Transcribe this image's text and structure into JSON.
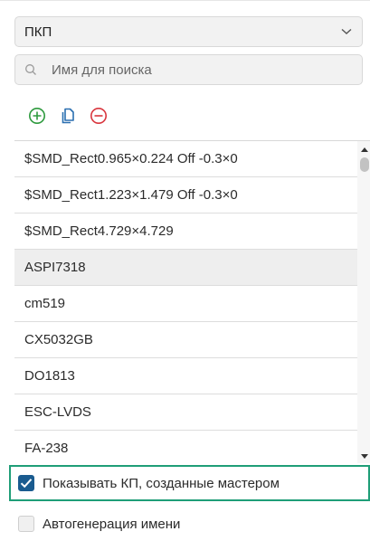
{
  "type_select": {
    "value": "ПКП",
    "icon": "chevron-down-icon"
  },
  "search": {
    "placeholder": "Имя для поиска",
    "value": "",
    "icon": "search-icon"
  },
  "toolbar": {
    "add_icon": "plus-circle-icon",
    "copy_icon": "copy-icon",
    "remove_icon": "minus-circle-icon",
    "colors": {
      "add": "#2e9a3e",
      "copy": "#2a6fb0",
      "remove": "#d9363e"
    }
  },
  "list": {
    "items": [
      {
        "label": "$SMD_Rect0.965×0.224 Off -0.3×0",
        "selected": false
      },
      {
        "label": "$SMD_Rect1.223×1.479 Off -0.3×0",
        "selected": false
      },
      {
        "label": "$SMD_Rect4.729×4.729",
        "selected": false
      },
      {
        "label": "ASPI7318",
        "selected": true
      },
      {
        "label": "cm519",
        "selected": false
      },
      {
        "label": "CX5032GB",
        "selected": false
      },
      {
        "label": "DO1813",
        "selected": false
      },
      {
        "label": "ESC-LVDS",
        "selected": false
      },
      {
        "label": "FA-238",
        "selected": false
      }
    ]
  },
  "options": {
    "show_wizard": {
      "label": "Показывать КП, созданные мастером",
      "checked": true
    },
    "autogen_name": {
      "label": "Автогенерация имени",
      "checked": false
    }
  },
  "colors": {
    "accent": "#1a5b8f",
    "focus": "#1f9e78",
    "selected_row": "#eeeeee"
  }
}
